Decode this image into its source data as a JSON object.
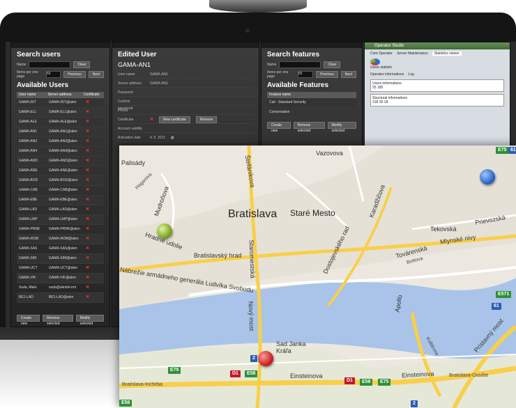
{
  "users_panel": {
    "title": "Search users",
    "name_label": "Name",
    "clear_label": "Clear",
    "items_label": "Items per one page",
    "items_value": "50",
    "previous_label": "Previous",
    "next_label": "Next",
    "list_title": "Available Users",
    "columns": [
      "User name",
      "Server address",
      "Certificate"
    ],
    "rows": [
      [
        "GAMA-06T",
        "GAMA-06T@alen"
      ],
      [
        "GAMA-ELL",
        "GAMA-ELL@alen"
      ],
      [
        "GAMA-ALE",
        "GAMA-ALE@alen"
      ],
      [
        "GAMA-AN1",
        "GAMA-AN1@alen"
      ],
      [
        "GAMA-AN2",
        "GAMA-AN2@alen"
      ],
      [
        "GAMA-AN4",
        "GAMA-AN4@alen"
      ],
      [
        "GAMA-AND",
        "GAMA-AND@alen"
      ],
      [
        "GAMA-ANE",
        "GAMA-ANE@alen"
      ],
      [
        "GAMA-BOD",
        "GAMA-BOD@alen"
      ],
      [
        "GAMA-CAB",
        "GAMA-CAB@alen"
      ],
      [
        "GAMA-EBE",
        "GAMA-EBE@alen"
      ],
      [
        "GAMA-LAD",
        "GAMA-LAD@alen"
      ],
      [
        "GAMA-LMP",
        "GAMA-LMP@alen"
      ],
      [
        "GAMA-PRNK",
        "GAMA-PRNK@alen"
      ],
      [
        "GAMA-ROM",
        "GAMA-ROM@alen"
      ],
      [
        "GAMA-SAS",
        "GAMA-SAS@alen"
      ],
      [
        "GAMA-SIM",
        "GAMA-SIM@alen"
      ],
      [
        "GAMA-UCT",
        "GAMA-UCT@alen"
      ],
      [
        "GAMA-VIK",
        "GAMA-VIK@alen"
      ],
      [
        "Suda, Mark",
        "suda@alentel.ent"
      ],
      [
        "BE1-LAD",
        "BE1-LAD@alen"
      ]
    ],
    "create_label": "Create new",
    "remove_label": "Remove selected",
    "modify_label": "Modify selected"
  },
  "edit_panel": {
    "title": "Edited User",
    "user": "GAMA-AN1",
    "fields": [
      [
        "User name",
        "GAMA-AN1"
      ],
      [
        "Server address",
        "GAMA-AN1"
      ],
      [
        "Password",
        ""
      ],
      [
        "Confirm password",
        ""
      ],
      [
        "Phone",
        ""
      ],
      [
        "Certificate",
        ""
      ],
      [
        "Account validity",
        ""
      ],
      [
        "Activation date",
        "4. 5. 2011"
      ]
    ],
    "new_cert_label": "New certificate",
    "remove_label": "Remove"
  },
  "features_panel": {
    "title": "Search features",
    "name_label": "Name",
    "clear_label": "Clear",
    "items_label": "Items per one page",
    "items_value": "50",
    "previous_label": "Previous",
    "next_label": "Next",
    "list_title": "Available Features",
    "column": "Feature name",
    "rows": [
      "Call - Standard Security",
      "Conversation"
    ],
    "create_label": "Create new",
    "remove_label": "Remove selected",
    "modify_label": "Modify selected"
  },
  "studio_panel": {
    "title": "Operator Studio",
    "tabs": [
      "Core Operator",
      "Server Maintenance",
      "Statistics viewer"
    ],
    "users_stats_label": "Users statistic",
    "sub_tabs": [
      "Operator informations",
      "Log"
    ],
    "users_info": "Users informations",
    "users_counts": "25   185",
    "structural_info": "Structural informations",
    "structural_counts": "218   26   18"
  },
  "map": {
    "labels": [
      "Vazovova",
      "Štefánikova",
      "Bratislava",
      "Staré Mesto",
      "Karadžičova",
      "Mudroňova",
      "Palisády",
      "Tekovská",
      "Prievozská",
      "Mlynské nivy",
      "Továrenská",
      "Bottova",
      "Hradné údolie",
      "Bratislavský hrad",
      "Nábrežie armádneho generála Ludvíka Svobodu",
      "Staromestská",
      "Dostojevského rad",
      "Nový most",
      "Apollo",
      "Sad Janka Kráľa",
      "Einsteinova",
      "Einsteinova",
      "Bratislava-Incheba",
      "Bratislava-Ovsište",
      "Prístavný most",
      "Kollárova",
      "Hagarova"
    ],
    "shields": [
      "E75",
      "D1",
      "E58",
      "2",
      "D1",
      "E58",
      "E75",
      "E571",
      "61",
      "E58",
      "2",
      "E75",
      "61"
    ]
  }
}
